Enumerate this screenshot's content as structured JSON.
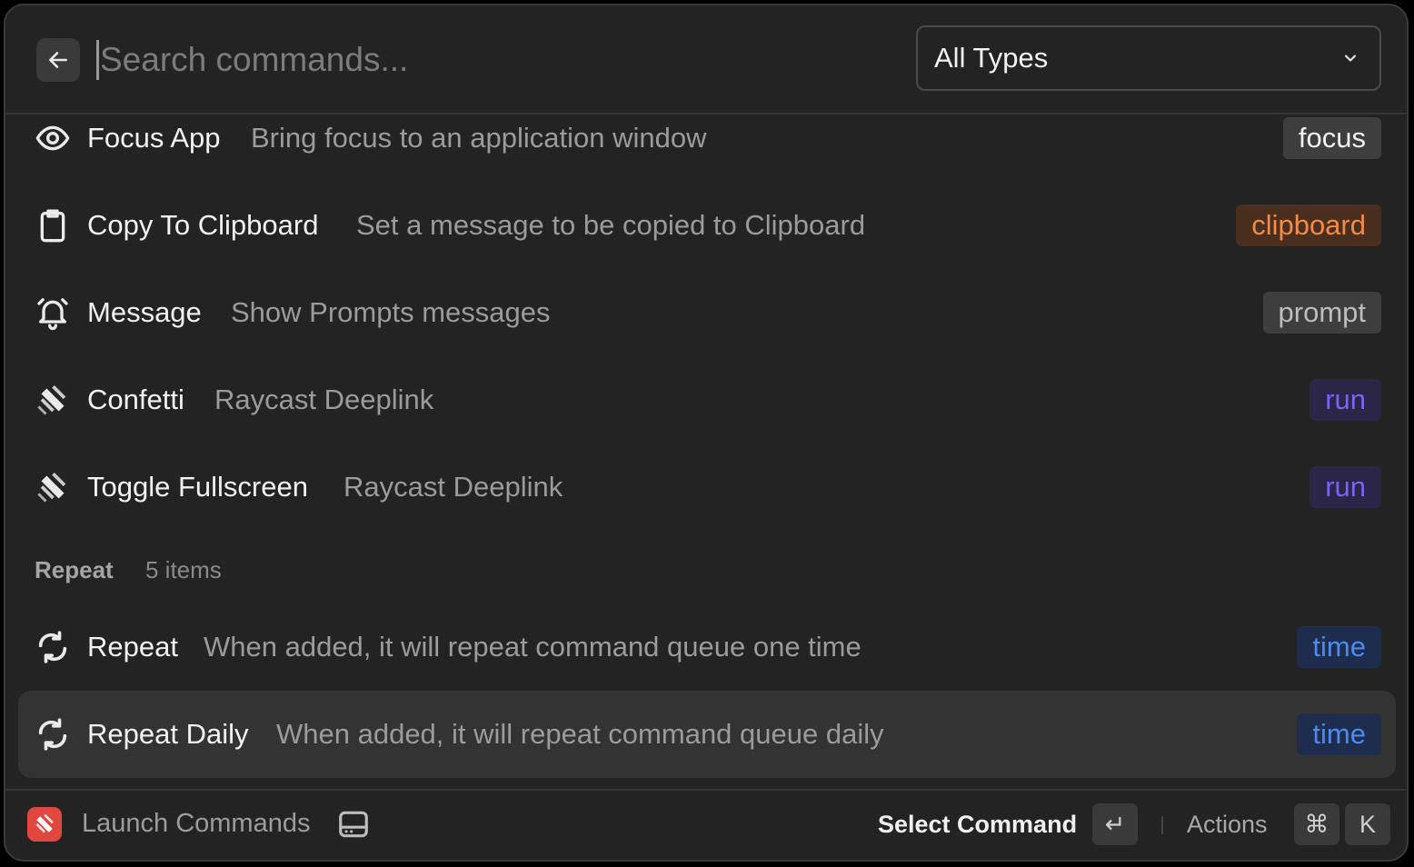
{
  "search": {
    "placeholder": "Search commands..."
  },
  "filter": {
    "selected": "All Types"
  },
  "items": [
    {
      "title": "Focus App",
      "subtitle": "Bring focus to an application window",
      "tag": "focus",
      "icon": "eye-icon"
    },
    {
      "title": "Copy To Clipboard",
      "subtitle": "Set a message to be copied to Clipboard",
      "tag": "clipboard",
      "icon": "clipboard-icon"
    },
    {
      "title": "Message",
      "subtitle": "Show Prompts messages",
      "tag": "prompt",
      "icon": "bell-icon"
    },
    {
      "title": "Confetti",
      "subtitle": "Raycast Deeplink",
      "tag": "run",
      "icon": "raycast-icon"
    },
    {
      "title": "Toggle Fullscreen",
      "subtitle": "Raycast Deeplink",
      "tag": "run",
      "icon": "raycast-icon"
    }
  ],
  "section": {
    "label": "Repeat",
    "count": "5 items"
  },
  "repeat_items": [
    {
      "title": "Repeat",
      "subtitle": "When added, it will repeat command queue one time",
      "tag": "time",
      "icon": "repeat-icon"
    },
    {
      "title": "Repeat Daily",
      "subtitle": "When added, it will repeat command queue daily",
      "tag": "time",
      "icon": "repeat-icon"
    }
  ],
  "footer": {
    "app_name": "Launch Commands",
    "primary_action": "Select Command",
    "enter_key": "↵",
    "actions_label": "Actions",
    "cmd_key": "⌘",
    "k_key": "K"
  },
  "colors": {
    "tag_orange": "#f38a45",
    "tag_purple": "#7b62f2",
    "tag_blue": "#4b8af0",
    "accent_red": "#e2473f"
  }
}
